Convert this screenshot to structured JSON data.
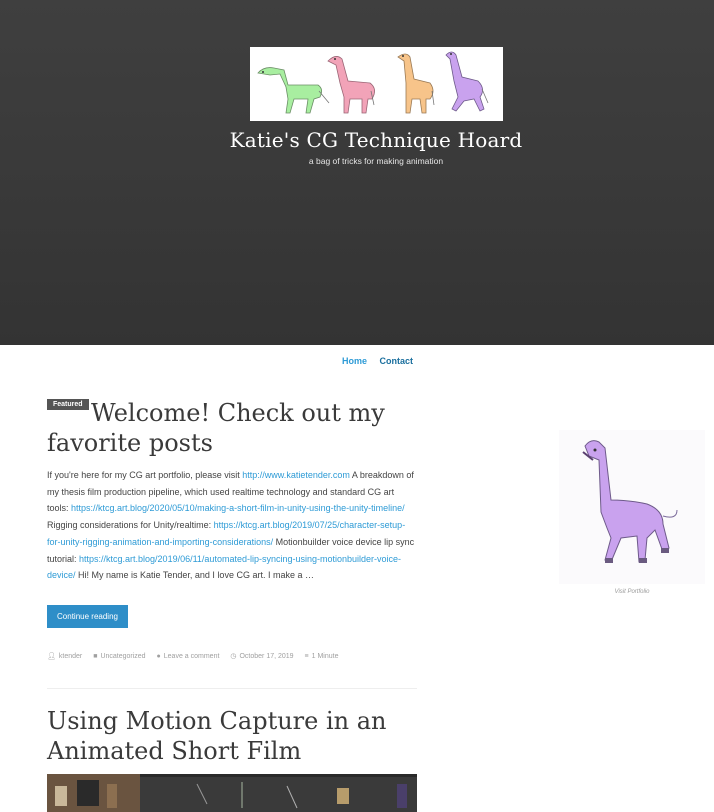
{
  "header": {
    "site_title": "Katie's CG Technique Hoard",
    "tagline": "a bag of tricks for making animation",
    "logo_colors": [
      "#a8eea0",
      "#f2a3b8",
      "#f7c48a",
      "#c9a2ee"
    ]
  },
  "nav": {
    "items": [
      {
        "label": "Home",
        "color": "#2e9bd6"
      },
      {
        "label": "Contact",
        "color": "#1a6f9e"
      }
    ]
  },
  "post1": {
    "badge": "Featured",
    "title": "Welcome! Check out my favorite posts",
    "excerpt": [
      {
        "text": "If you're here for my CG art portfolio, please visit "
      },
      {
        "text": "http://www.katietender.com",
        "link": true
      },
      {
        "text": " A breakdown of my thesis film production pipeline, which used realtime technology and standard CG art tools: "
      },
      {
        "text": "https://ktcg.art.blog/2020/05/10/making-a-short-film-in-unity-using-the-unity-timeline/",
        "link": true
      },
      {
        "text": " Rigging considerations for Unity/realtime: "
      },
      {
        "text": "https://ktcg.art.blog/2019/07/25/character-setup-for-unity-rigging-animation-and-importing-considerations/",
        "link": true
      },
      {
        "text": " Motionbuilder voice device lip sync tutorial: "
      },
      {
        "text": "https://ktcg.art.blog/2019/06/11/automated-lip-syncing-using-motionbuilder-voice-device/",
        "link": true
      },
      {
        "text": " Hi! My name is Katie Tender, and I love CG art. I make a …"
      }
    ],
    "button": "Continue reading",
    "meta": {
      "author": "ktender",
      "category": "Uncategorized",
      "comment": "Leave a comment",
      "date": "October 17, 2019",
      "read_time": "1 Minute"
    }
  },
  "post2": {
    "title": "Using Motion Capture in an Animated Short Film"
  },
  "sidebar": {
    "caption": "Visit Portfolio"
  },
  "icons": {
    "author": "person-icon",
    "category": "folder-icon",
    "comment": "comment-icon",
    "date": "clock-icon",
    "read_time": "stack-icon"
  }
}
